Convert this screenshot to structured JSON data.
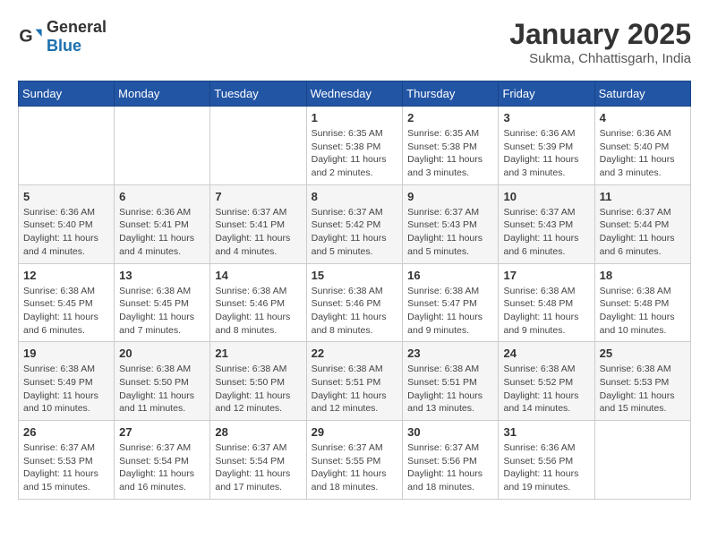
{
  "header": {
    "logo_general": "General",
    "logo_blue": "Blue",
    "month": "January 2025",
    "location": "Sukma, Chhattisgarh, India"
  },
  "days_of_week": [
    "Sunday",
    "Monday",
    "Tuesday",
    "Wednesday",
    "Thursday",
    "Friday",
    "Saturday"
  ],
  "weeks": [
    [
      {
        "day": "",
        "info": ""
      },
      {
        "day": "",
        "info": ""
      },
      {
        "day": "",
        "info": ""
      },
      {
        "day": "1",
        "info": "Sunrise: 6:35 AM\nSunset: 5:38 PM\nDaylight: 11 hours and 2 minutes."
      },
      {
        "day": "2",
        "info": "Sunrise: 6:35 AM\nSunset: 5:38 PM\nDaylight: 11 hours and 3 minutes."
      },
      {
        "day": "3",
        "info": "Sunrise: 6:36 AM\nSunset: 5:39 PM\nDaylight: 11 hours and 3 minutes."
      },
      {
        "day": "4",
        "info": "Sunrise: 6:36 AM\nSunset: 5:40 PM\nDaylight: 11 hours and 3 minutes."
      }
    ],
    [
      {
        "day": "5",
        "info": "Sunrise: 6:36 AM\nSunset: 5:40 PM\nDaylight: 11 hours and 4 minutes."
      },
      {
        "day": "6",
        "info": "Sunrise: 6:36 AM\nSunset: 5:41 PM\nDaylight: 11 hours and 4 minutes."
      },
      {
        "day": "7",
        "info": "Sunrise: 6:37 AM\nSunset: 5:41 PM\nDaylight: 11 hours and 4 minutes."
      },
      {
        "day": "8",
        "info": "Sunrise: 6:37 AM\nSunset: 5:42 PM\nDaylight: 11 hours and 5 minutes."
      },
      {
        "day": "9",
        "info": "Sunrise: 6:37 AM\nSunset: 5:43 PM\nDaylight: 11 hours and 5 minutes."
      },
      {
        "day": "10",
        "info": "Sunrise: 6:37 AM\nSunset: 5:43 PM\nDaylight: 11 hours and 6 minutes."
      },
      {
        "day": "11",
        "info": "Sunrise: 6:37 AM\nSunset: 5:44 PM\nDaylight: 11 hours and 6 minutes."
      }
    ],
    [
      {
        "day": "12",
        "info": "Sunrise: 6:38 AM\nSunset: 5:45 PM\nDaylight: 11 hours and 6 minutes."
      },
      {
        "day": "13",
        "info": "Sunrise: 6:38 AM\nSunset: 5:45 PM\nDaylight: 11 hours and 7 minutes."
      },
      {
        "day": "14",
        "info": "Sunrise: 6:38 AM\nSunset: 5:46 PM\nDaylight: 11 hours and 8 minutes."
      },
      {
        "day": "15",
        "info": "Sunrise: 6:38 AM\nSunset: 5:46 PM\nDaylight: 11 hours and 8 minutes."
      },
      {
        "day": "16",
        "info": "Sunrise: 6:38 AM\nSunset: 5:47 PM\nDaylight: 11 hours and 9 minutes."
      },
      {
        "day": "17",
        "info": "Sunrise: 6:38 AM\nSunset: 5:48 PM\nDaylight: 11 hours and 9 minutes."
      },
      {
        "day": "18",
        "info": "Sunrise: 6:38 AM\nSunset: 5:48 PM\nDaylight: 11 hours and 10 minutes."
      }
    ],
    [
      {
        "day": "19",
        "info": "Sunrise: 6:38 AM\nSunset: 5:49 PM\nDaylight: 11 hours and 10 minutes."
      },
      {
        "day": "20",
        "info": "Sunrise: 6:38 AM\nSunset: 5:50 PM\nDaylight: 11 hours and 11 minutes."
      },
      {
        "day": "21",
        "info": "Sunrise: 6:38 AM\nSunset: 5:50 PM\nDaylight: 11 hours and 12 minutes."
      },
      {
        "day": "22",
        "info": "Sunrise: 6:38 AM\nSunset: 5:51 PM\nDaylight: 11 hours and 12 minutes."
      },
      {
        "day": "23",
        "info": "Sunrise: 6:38 AM\nSunset: 5:51 PM\nDaylight: 11 hours and 13 minutes."
      },
      {
        "day": "24",
        "info": "Sunrise: 6:38 AM\nSunset: 5:52 PM\nDaylight: 11 hours and 14 minutes."
      },
      {
        "day": "25",
        "info": "Sunrise: 6:38 AM\nSunset: 5:53 PM\nDaylight: 11 hours and 15 minutes."
      }
    ],
    [
      {
        "day": "26",
        "info": "Sunrise: 6:37 AM\nSunset: 5:53 PM\nDaylight: 11 hours and 15 minutes."
      },
      {
        "day": "27",
        "info": "Sunrise: 6:37 AM\nSunset: 5:54 PM\nDaylight: 11 hours and 16 minutes."
      },
      {
        "day": "28",
        "info": "Sunrise: 6:37 AM\nSunset: 5:54 PM\nDaylight: 11 hours and 17 minutes."
      },
      {
        "day": "29",
        "info": "Sunrise: 6:37 AM\nSunset: 5:55 PM\nDaylight: 11 hours and 18 minutes."
      },
      {
        "day": "30",
        "info": "Sunrise: 6:37 AM\nSunset: 5:56 PM\nDaylight: 11 hours and 18 minutes."
      },
      {
        "day": "31",
        "info": "Sunrise: 6:36 AM\nSunset: 5:56 PM\nDaylight: 11 hours and 19 minutes."
      },
      {
        "day": "",
        "info": ""
      }
    ]
  ]
}
